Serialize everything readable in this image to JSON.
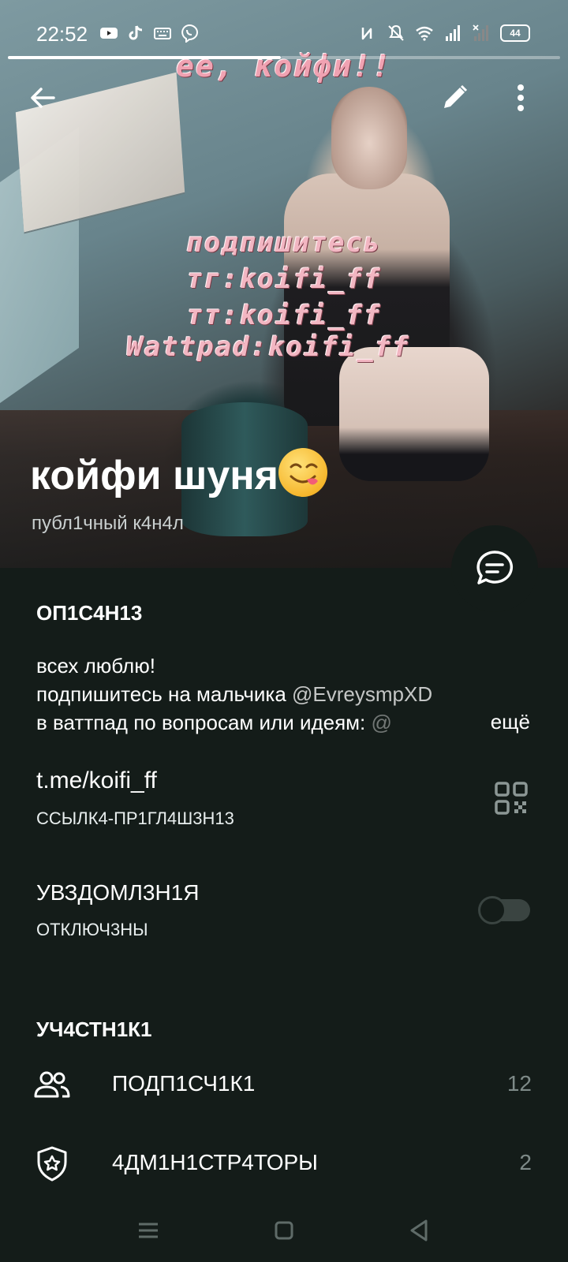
{
  "status_bar": {
    "time": "22:52",
    "battery": "44",
    "left_icons": [
      "youtube-icon",
      "tiktok-icon",
      "keyboard-icon",
      "viber-icon"
    ],
    "right_icons": [
      "nfc-icon",
      "mute-icon",
      "wifi-icon",
      "signal-icon",
      "signal-no-service-icon",
      "battery-icon"
    ]
  },
  "toolbar": {
    "back_icon": "arrow-left-icon",
    "edit_icon": "pencil-icon",
    "more_icon": "more-vertical-icon"
  },
  "cover_image_text": {
    "top_line": "ee, койфи!!",
    "line1": "подпишитесь",
    "line2": "тг:koifi_ff",
    "line3": "тт:koifi_ff",
    "line4": "Wattpad:koifi_ff"
  },
  "channel": {
    "title": "койфи шуня",
    "title_emoji": "😋",
    "subtitle": "публ1чный к4н4л"
  },
  "description": {
    "heading": "ОП1С4Н13",
    "line1": "всех люблю!",
    "line2_prefix": "подпишитесь на мальчика ",
    "line2_mention": "@EvreysmpXD",
    "line3_prefix": "в ваттпад по вопросам или идеям: ",
    "line3_mention": "@",
    "more_label": "ещё"
  },
  "invite_link": {
    "url": "t.me/koifi_ff",
    "label": "ССЫЛК4-ПР1ГЛ4Ш3Н13",
    "qr_icon": "qr-code-icon"
  },
  "notifications": {
    "title": "УВЗДОМЛ3Н1Я",
    "state": "ОТКЛЮЧ3НЫ",
    "enabled": false
  },
  "participants": {
    "heading": "УЧ4СТН1К1",
    "rows": [
      {
        "icon": "people-icon",
        "label": "ПОДП1СЧ1К1",
        "count": "12"
      },
      {
        "icon": "shield-star-icon",
        "label": "4ДМ1Н1СТР4ТОРЫ",
        "count": "2"
      }
    ]
  },
  "navbar": {
    "icons": [
      "menu-icon",
      "home-square-icon",
      "back-triangle-icon"
    ]
  },
  "colors": {
    "background": "#141c19",
    "muted_text": "#7e8a88",
    "overlay_pink": "#f2b6c2"
  }
}
